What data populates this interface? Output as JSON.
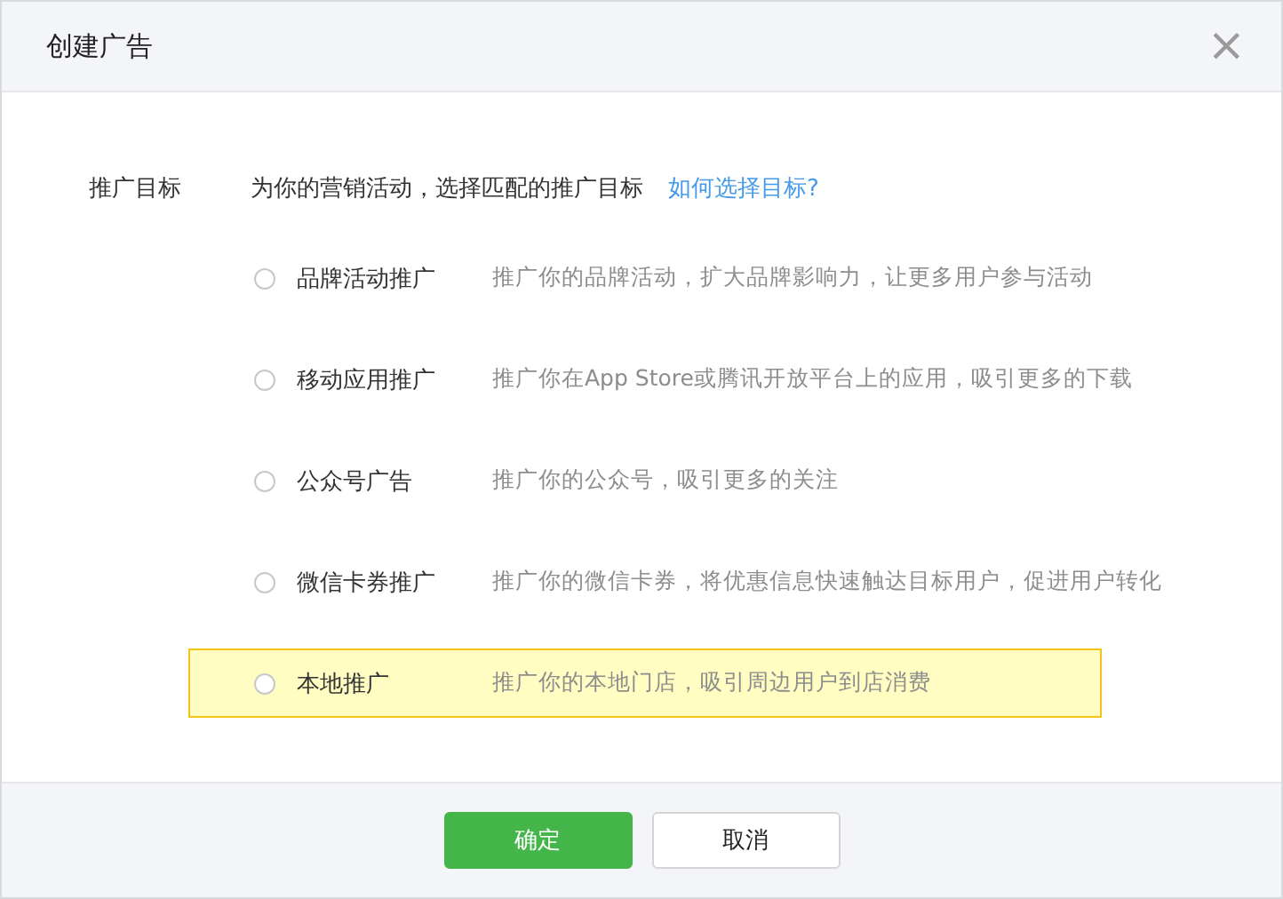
{
  "dialog": {
    "title": "创建广告",
    "close": "×"
  },
  "field": {
    "label": "推广目标",
    "prompt": "为你的营销活动，选择匹配的推广目标",
    "help_link": "如何选择目标?"
  },
  "options": [
    {
      "label": "品牌活动推广",
      "description": "推广你的品牌活动，扩大品牌影响力，让更多用户参与活动",
      "selected": false,
      "highlighted": false
    },
    {
      "label": "移动应用推广",
      "description": "推广你在App Store或腾讯开放平台上的应用，吸引更多的下载",
      "selected": false,
      "highlighted": false
    },
    {
      "label": "公众号广告",
      "description": "推广你的公众号，吸引更多的关注",
      "selected": false,
      "highlighted": false
    },
    {
      "label": "微信卡券推广",
      "description": "推广你的微信卡券，将优惠信息快速触达目标用户，促进用户转化",
      "selected": false,
      "highlighted": false
    },
    {
      "label": "本地推广",
      "description": "推广你的本地门店，吸引周边用户到店消费",
      "selected": false,
      "highlighted": true
    }
  ],
  "buttons": [
    {
      "label": "确定",
      "kind": "primary"
    },
    {
      "label": "取消",
      "kind": "default"
    }
  ]
}
